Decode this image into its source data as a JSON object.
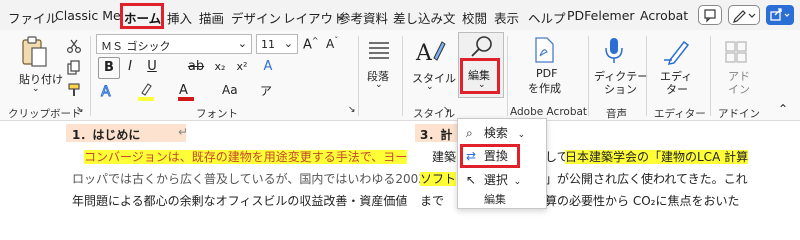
{
  "tabs": [
    "ファイル",
    "Classic Me",
    "ホーム",
    "挿入",
    "描画",
    "デザイン",
    "レイアウト",
    "参考資料",
    "差し込み文",
    "校閲",
    "表示",
    "ヘルプ",
    "PDFelemer",
    "Acrobat"
  ],
  "clipboard": {
    "paste_label": "貼り付け",
    "group_label": "クリップボード"
  },
  "font": {
    "name_value": "ＭＳ ゴシック",
    "size_value": "11",
    "group_label": "フォント",
    "bold": "B",
    "italic": "I",
    "underline": "U",
    "strike": "ab",
    "subscript": "x₂",
    "superscript": "x²",
    "clear": "A"
  },
  "paragraph": {
    "label": "段落"
  },
  "styles": {
    "label": "スタイル",
    "group_label": "スタイル"
  },
  "edit": {
    "label": "編集"
  },
  "pdf": {
    "label1": "PDF",
    "label2": "を作成",
    "group_label": "Adobe Acrobat"
  },
  "dictate": {
    "label": "ディクテー",
    "label2": "ション",
    "group_label": "音声"
  },
  "editor": {
    "label": "エディ",
    "label2": "ター",
    "group_label": "エディター"
  },
  "addins": {
    "label": "アド",
    "label2": "イン",
    "group_label": "アドイン"
  },
  "popup": {
    "search": "検索",
    "replace": "置換",
    "select": "選択",
    "group_label": "編集"
  },
  "doc": {
    "heading1": "1．はじめに",
    "heading3": "3．計",
    "line1_left": "コンバージョンは、既存の建物を用途変更する手法で、ヨー",
    "line1_right_a": "建築",
    "line1_right_b": "して",
    "line1_right_c": "日本建築学会の「建物のLCA 計算",
    "line2_left": "ロッパでは古くから広く普及しているが、国内ではいわゆる2003",
    "line2_right_a": "ソフト",
    "line2_right_b": "」が公開され広く使われてきた。これ",
    "line3_left": "年問題による都心の余剰なオフィスビルの収益改善・資産価値",
    "line3_right_a": "まで",
    "line3_right_b": "算の必要性から CO₂に焦点をおいた"
  },
  "colors": {
    "highlight": "#ffff38",
    "redbox": "#e0202a",
    "font_red": "#d01818",
    "accent_blue": "#2b6fd6"
  }
}
